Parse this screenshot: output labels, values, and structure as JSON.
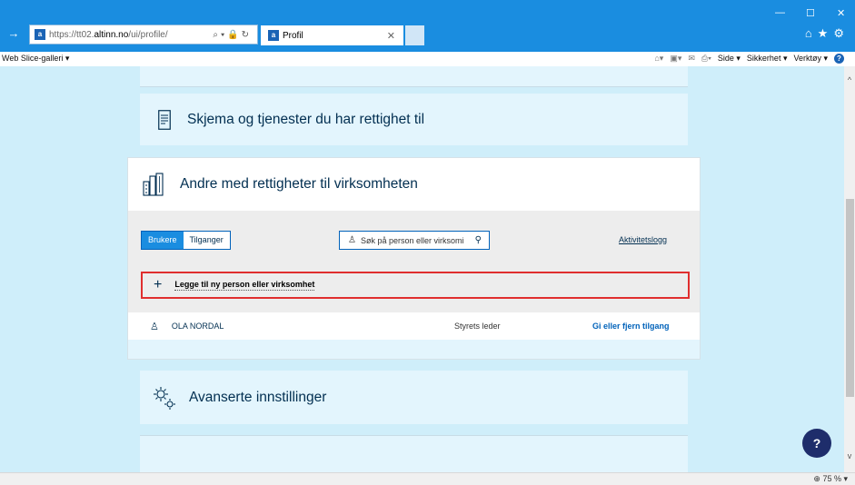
{
  "browser": {
    "url_proto": "https://tt02.",
    "url_host": "altinn.no",
    "url_path": "/ui/profile/",
    "tab_title": "Profil",
    "web_slice": "Web Slice-galleri ▾",
    "cmd_side": "Side ▾",
    "cmd_sikkerhet": "Sikkerhet ▾",
    "cmd_verktoy": "Verktøy ▾",
    "zoom": "75 %"
  },
  "sections": {
    "skjema_title": "Skjema og tjenester du har rettighet til",
    "andre_title": "Andre med rettigheter til virksomheten",
    "avansert_title": "Avanserte innstillinger"
  },
  "panel": {
    "tab_brukere": "Brukere",
    "tab_tilganger": "Tilganger",
    "search_placeholder": "Søk på person eller virksomi",
    "activity_link": "Aktivitetslogg",
    "add_label": "Legge til ny person eller virksomhet",
    "users": [
      {
        "name": "OLA NORDAL",
        "role": "Styrets leder",
        "action": "Gi eller fjern tilgang"
      }
    ]
  },
  "help_label": "?",
  "colors": {
    "accent": "#1a8de0",
    "page_bg": "#cfeefa",
    "card_bg": "#e3f5fd",
    "highlight": "#e02e2e"
  }
}
